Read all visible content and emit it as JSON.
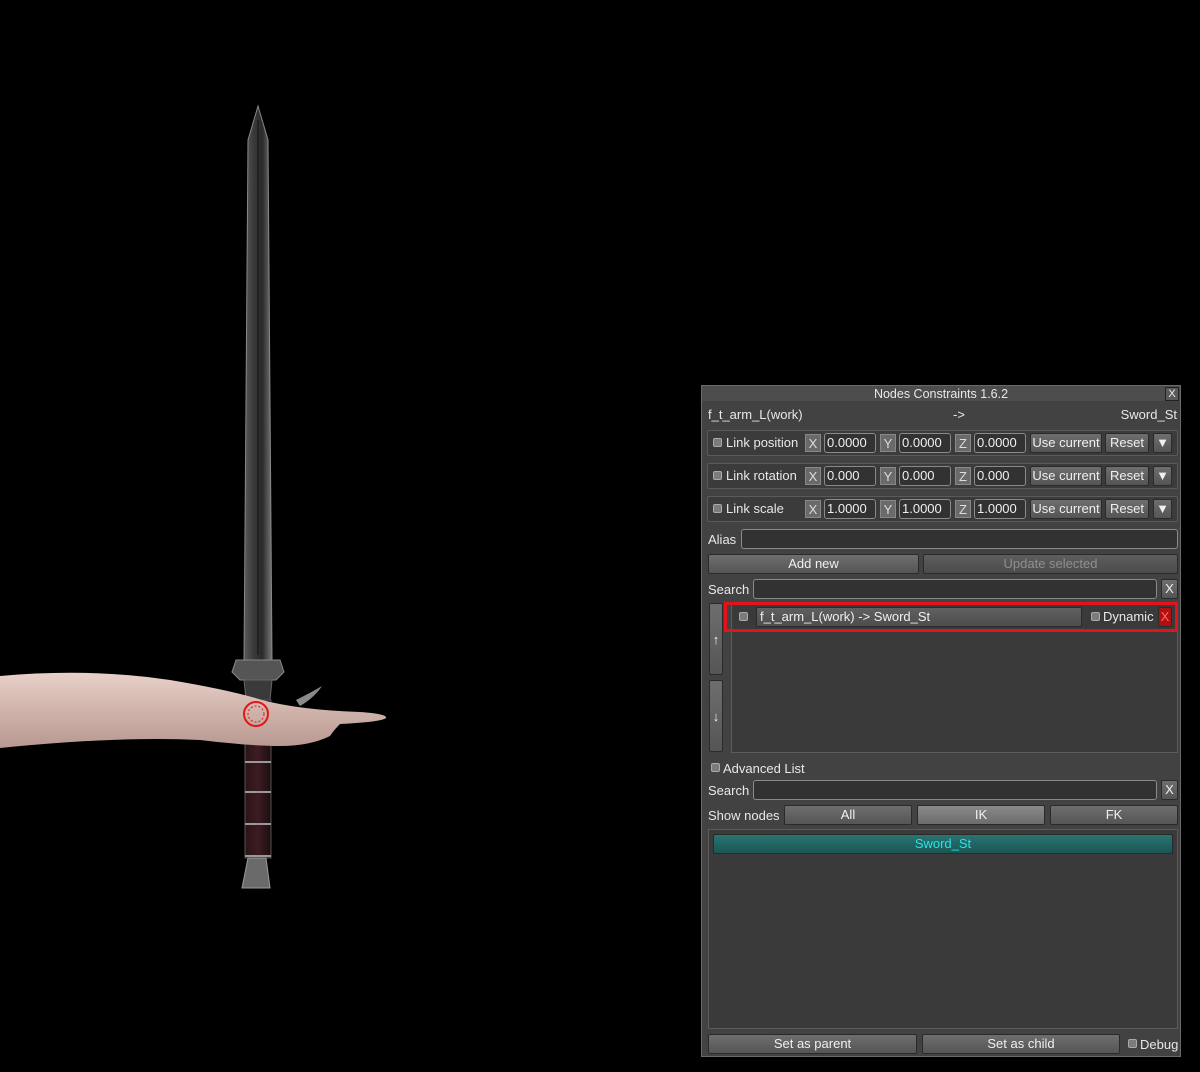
{
  "window": {
    "title": "Nodes Constraints 1.6.2",
    "close_label": "X"
  },
  "header": {
    "parent_node": "f_t_arm_L(work)",
    "arrow": "->",
    "child_node": "Sword_St"
  },
  "links": [
    {
      "label": "Link position",
      "x": "0.0000",
      "y": "0.0000",
      "z": "0.0000"
    },
    {
      "label": "Link rotation",
      "x": "0.000",
      "y": "0.000",
      "z": "0.000"
    },
    {
      "label": "Link scale",
      "x": "1.0000",
      "y": "1.0000",
      "z": "1.0000"
    }
  ],
  "axes": {
    "x": "X",
    "y": "Y",
    "z": "Z"
  },
  "link_buttons": {
    "use_current": "Use current",
    "reset": "Reset",
    "menu": "▼"
  },
  "alias": {
    "label": "Alias",
    "value": ""
  },
  "actions": {
    "add_new": "Add new",
    "update_selected": "Update selected"
  },
  "search": {
    "label": "Search",
    "value": "",
    "clear": "X"
  },
  "scroll": {
    "up": "↑",
    "down": "↓"
  },
  "constraints": [
    {
      "name": "f_t_arm_L(work) -> Sword_St",
      "dynamic_label": "Dynamic",
      "delete": "X"
    }
  ],
  "advanced_list": {
    "label": "Advanced List"
  },
  "search2": {
    "label": "Search",
    "value": "",
    "clear": "X"
  },
  "show_nodes": {
    "label": "Show nodes",
    "filters": [
      "All",
      "IK",
      "FK"
    ],
    "selected": "IK"
  },
  "nodes": [
    "Sword_St"
  ],
  "footer": {
    "set_parent": "Set as parent",
    "set_child": "Set as child",
    "debug": "Debug"
  },
  "colors": {
    "accent": "#e0141a",
    "node_text": "#20e8e8",
    "node_bg": "#1f5f5e"
  }
}
